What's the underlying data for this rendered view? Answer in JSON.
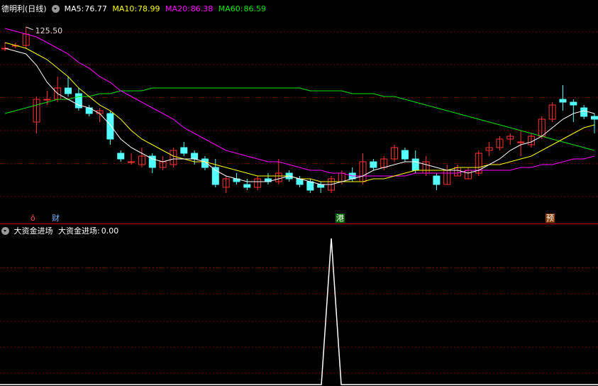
{
  "header": {
    "stock": "德明利(日线)",
    "ma5_label": "MA5:",
    "ma5_value": "76.77",
    "ma10_label": "MA10:",
    "ma10_value": "78.99",
    "ma20_label": "MA20:",
    "ma20_value": "86.38",
    "ma60_label": "MA60:",
    "ma60_value": "86.59"
  },
  "colors": {
    "up": "#ff3232",
    "down": "#54ffff",
    "ma5": "#ffffff",
    "ma10": "#ffff00",
    "ma20": "#ff00ff",
    "ma60": "#00e600",
    "grid": "#7a0000"
  },
  "indicator": {
    "name": "大资金进场",
    "label": "大资金进场:",
    "value": "0.00"
  },
  "markers": [
    {
      "text": "ǒ",
      "color": "#ff5050",
      "bg": "#000"
    },
    {
      "text": "财",
      "color": "#7fb3ff",
      "bg": "#000"
    },
    {
      "text": "港",
      "color": "#ffffff",
      "bg": "#006a00"
    },
    {
      "text": "预",
      "color": "#ffffff",
      "bg": "#8a3a00"
    }
  ],
  "chart_data": [
    {
      "type": "candlestick",
      "max_price_label": "125.50",
      "price_range": [
        60,
        130
      ],
      "ohlc": [
        [
          118,
          120,
          117,
          118
        ],
        [
          119,
          120,
          118,
          119
        ],
        [
          119,
          125.5,
          118,
          123
        ],
        [
          92,
          101,
          88,
          100
        ],
        [
          100,
          103,
          98,
          100
        ],
        [
          100,
          108,
          99,
          104
        ],
        [
          104,
          108,
          101,
          102
        ],
        [
          102,
          104,
          96,
          97
        ],
        [
          97,
          98,
          94,
          95
        ],
        [
          95,
          97,
          92,
          96
        ],
        [
          95,
          96,
          84,
          86
        ],
        [
          81,
          82,
          78,
          79
        ],
        [
          78,
          81,
          77,
          78
        ],
        [
          77,
          83,
          76,
          80
        ],
        [
          80,
          81,
          74,
          76
        ],
        [
          76,
          80,
          75,
          78
        ],
        [
          77,
          83,
          76,
          82
        ],
        [
          83,
          85,
          80,
          81
        ],
        [
          81,
          82,
          77,
          79
        ],
        [
          79,
          80,
          75,
          76
        ],
        [
          76,
          79,
          69,
          70
        ],
        [
          69,
          73,
          67,
          72
        ],
        [
          72,
          74,
          70,
          71
        ],
        [
          70,
          72,
          68,
          69
        ],
        [
          69,
          73,
          68,
          72
        ],
        [
          72,
          74,
          70,
          71
        ],
        [
          71,
          79,
          70,
          74
        ],
        [
          74,
          75,
          71,
          72
        ],
        [
          72,
          73,
          69,
          70
        ],
        [
          71,
          72,
          67,
          68
        ],
        [
          70,
          71,
          67,
          69
        ],
        [
          68,
          73,
          67,
          72
        ],
        [
          71,
          75,
          70,
          74
        ],
        [
          74,
          76,
          71,
          72
        ],
        [
          71,
          81,
          70,
          78
        ],
        [
          78,
          79,
          75,
          76
        ],
        [
          76,
          80,
          75,
          79
        ],
        [
          79,
          84,
          78,
          83
        ],
        [
          82,
          83,
          78,
          79
        ],
        [
          79,
          82,
          74,
          75
        ],
        [
          74,
          80,
          73,
          78
        ],
        [
          73,
          74,
          68,
          70
        ],
        [
          70,
          77,
          70,
          75
        ],
        [
          73,
          77,
          73,
          76
        ],
        [
          72,
          76,
          72,
          75
        ],
        [
          74,
          82,
          73,
          81
        ],
        [
          82,
          85,
          80,
          83
        ],
        [
          83,
          87,
          82,
          86
        ],
        [
          86,
          88,
          84,
          87
        ],
        [
          85,
          89,
          80,
          85
        ],
        [
          84,
          88,
          83,
          87
        ],
        [
          87,
          94,
          86,
          93
        ],
        [
          93,
          99,
          92,
          98
        ],
        [
          100,
          105,
          96,
          99
        ],
        [
          99,
          100,
          92,
          98
        ],
        [
          97,
          98,
          93,
          94
        ],
        [
          94,
          95,
          88,
          93
        ]
      ],
      "ma5": [
        118,
        117,
        116,
        112,
        106,
        102,
        100,
        98,
        97,
        95,
        91,
        86,
        83,
        81,
        79,
        78,
        79,
        79,
        79,
        78,
        75,
        73,
        72,
        71,
        71,
        71,
        72,
        73,
        72,
        71,
        70,
        70,
        71,
        72,
        73,
        75,
        76,
        77,
        78,
        78,
        77,
        76,
        75,
        75,
        74,
        75,
        77,
        79,
        82,
        84,
        85,
        87,
        90,
        93,
        95,
        96,
        95
      ],
      "ma10": [
        120,
        119,
        118,
        116,
        114,
        111,
        108,
        104,
        101,
        98,
        96,
        93,
        89,
        86,
        84,
        82,
        80,
        79,
        78,
        78,
        77,
        76,
        75,
        74,
        73,
        73,
        73,
        73,
        72,
        72,
        71,
        71,
        71,
        71,
        71,
        72,
        72,
        73,
        74,
        75,
        75,
        75,
        75,
        76,
        76,
        76,
        77,
        77,
        78,
        79,
        80,
        82,
        84,
        86,
        88,
        90,
        91
      ],
      "ma20": [
        125,
        124,
        123,
        122,
        120,
        118,
        116,
        113,
        111,
        108,
        106,
        103,
        101,
        99,
        97,
        95,
        93,
        90,
        88,
        86,
        84,
        82,
        81,
        80,
        79,
        78,
        78,
        77,
        76,
        75,
        75,
        74,
        74,
        73,
        73,
        73,
        73,
        73,
        73,
        74,
        74,
        74,
        74,
        74,
        75,
        75,
        75,
        75,
        75,
        76,
        76,
        77,
        77,
        78,
        79,
        79,
        80
      ],
      "ma60": [
        95,
        96,
        97,
        98,
        99,
        100,
        100,
        101,
        101,
        102,
        102,
        103,
        103,
        103,
        104,
        104,
        104,
        104,
        104,
        104,
        104,
        104,
        104,
        104,
        104,
        104,
        104,
        104,
        104,
        103,
        103,
        103,
        103,
        102,
        102,
        102,
        101,
        101,
        100,
        99,
        98,
        97,
        96,
        95,
        94,
        93,
        92,
        91,
        90,
        89,
        88,
        87,
        86,
        85,
        84,
        83,
        82
      ]
    },
    {
      "type": "line",
      "name": "大资金进场",
      "range": [
        0,
        1
      ],
      "spike_index": 31,
      "values_note": "zero everywhere except one spike"
    }
  ]
}
